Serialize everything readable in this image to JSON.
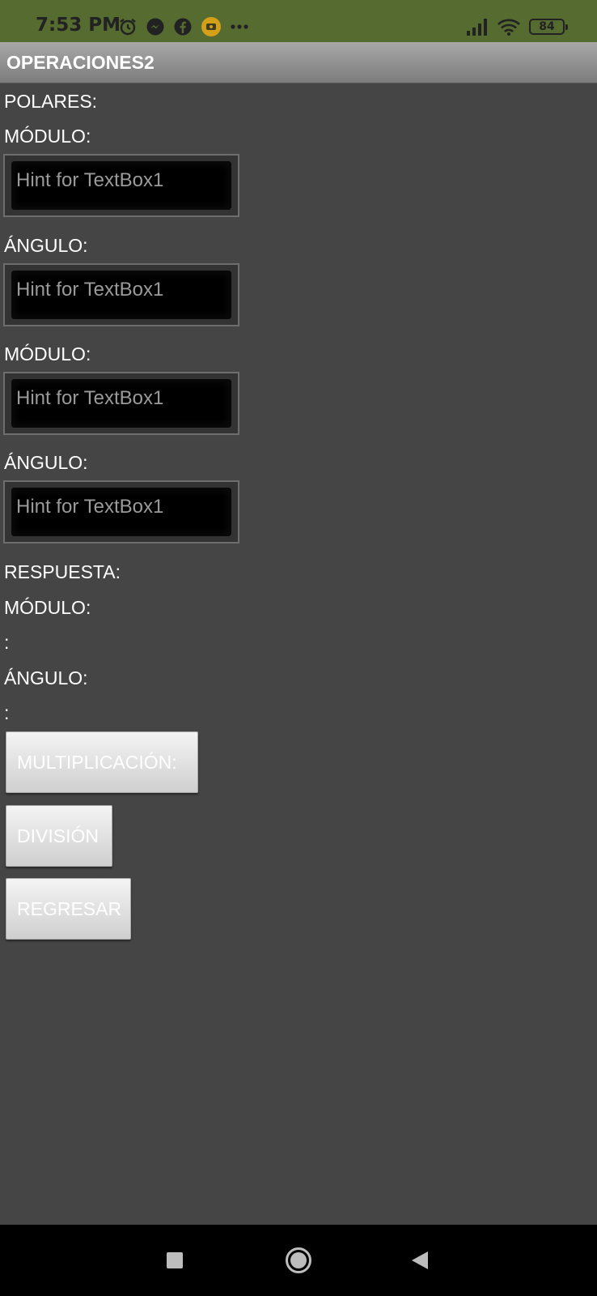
{
  "status_bar": {
    "time": "7:53 PM",
    "icons_left": [
      "alarm-icon",
      "messenger-icon",
      "facebook-icon",
      "app-notification-icon",
      "more-notifications-icon"
    ],
    "icons_right": [
      "signal-icon",
      "wifi-icon"
    ],
    "battery_level": "84",
    "background": "#556b2f"
  },
  "title_bar": {
    "title": "OPERACIONES2"
  },
  "labels": {
    "polares": "POLARES:",
    "modulo1": "MÓDULO:",
    "angulo1": "ÁNGULO:",
    "modulo2": "MÓDULO:",
    "angulo2": "ÁNGULO:",
    "respuesta": "RESPUESTA:",
    "result_modulo": "MÓDULO:",
    "result_modulo_value": ":",
    "result_angulo": "ÁNGULO:",
    "result_angulo_value": ":"
  },
  "inputs": {
    "modulo1_placeholder": "Hint for TextBox1",
    "angulo1_placeholder": "Hint for TextBox1",
    "modulo2_placeholder": "Hint for TextBox1",
    "angulo2_placeholder": "Hint for TextBox1"
  },
  "buttons": {
    "multiplicacion": "MULTIPLICACIÓN:",
    "division": "DIVISIÓN",
    "regresar": "REGRESAR"
  },
  "nav_bar": {
    "icons": [
      "recent-apps-icon",
      "home-icon",
      "back-icon"
    ]
  },
  "colors": {
    "screen_background": "#454545",
    "title_bar": "#9a9a9a",
    "button_face": "#e0e0e0",
    "text": "#ffffff"
  }
}
